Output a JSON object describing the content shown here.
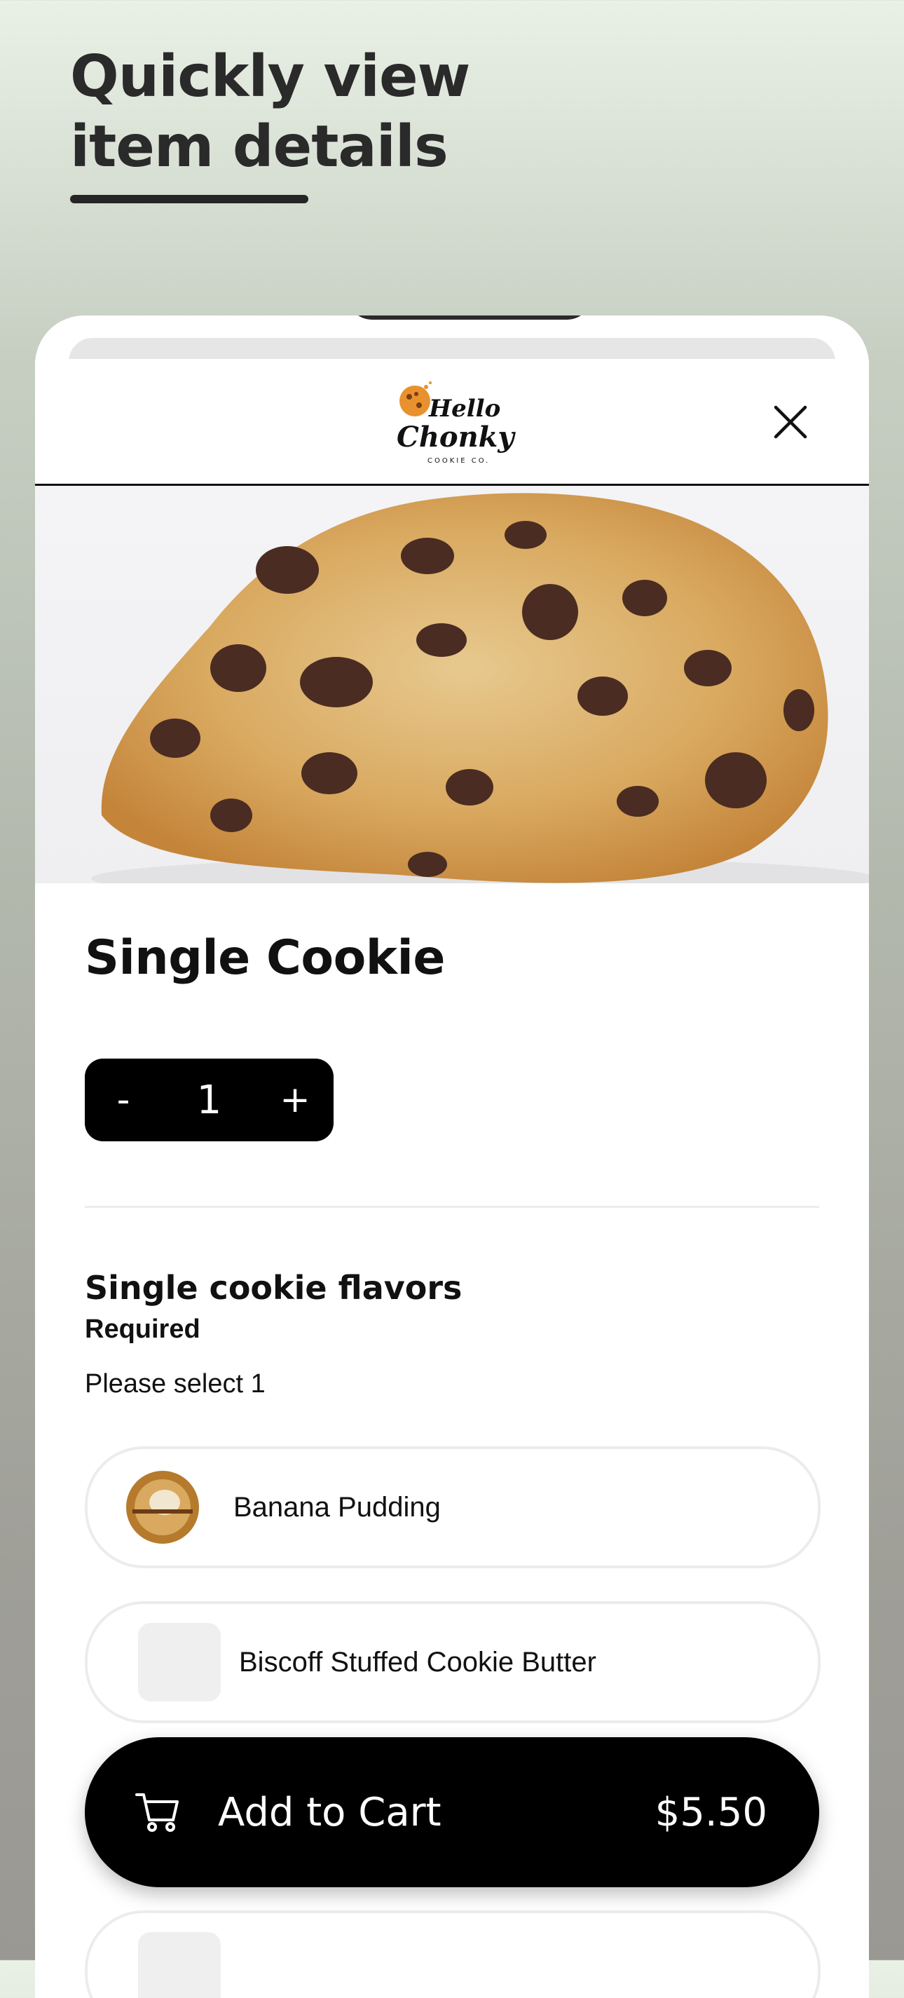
{
  "promo": {
    "headline": "Quickly view item details"
  },
  "header": {
    "logo_text_line1": "Hello",
    "logo_text_line2": "Chonky",
    "logo_text_line3": "COOKIE CO."
  },
  "product": {
    "title": "Single Cookie",
    "quantity": "1",
    "decrement_label": "-",
    "increment_label": "+"
  },
  "options_section": {
    "title": "Single cookie flavors",
    "required_label": "Required",
    "hint": "Please select 1",
    "options": [
      {
        "label": "Banana Pudding"
      },
      {
        "label": "Biscoff Stuffed Cookie Butter"
      }
    ]
  },
  "cart_button": {
    "label": "Add to Cart",
    "price": "$5.50"
  },
  "colors": {
    "accent": "#000000",
    "cookie_orange": "#e8912e"
  }
}
